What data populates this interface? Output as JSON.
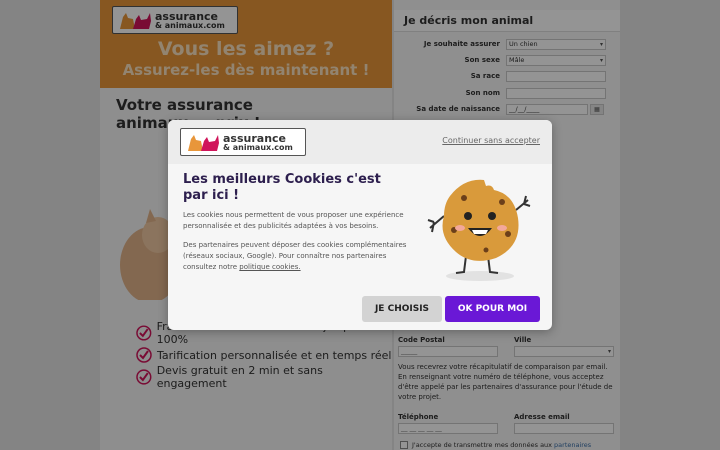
{
  "brand": {
    "name_line1": "assurance",
    "name_line2": "& animaux",
    "name_suffix": ".com"
  },
  "hero": {
    "headline": "Vous les aimez ?",
    "subline": "Assurez-les dès maintenant !"
  },
  "left": {
    "tagline": "Votre assurance animaux ... prix !",
    "benefits": [
      "Frais vétérinaires remboursés jusqu'à 100%",
      "Tarification personnalisée et en temps réel",
      "Devis gratuit en 2 min et sans engagement"
    ]
  },
  "form": {
    "title": "Je décris mon animal",
    "fields": [
      {
        "label": "Je souhaite assurer",
        "value": "Un chien",
        "type": "select"
      },
      {
        "label": "Son sexe",
        "value": "Mâle",
        "type": "select"
      },
      {
        "label": "Sa race",
        "value": "",
        "type": "text"
      },
      {
        "label": "Son nom",
        "value": "",
        "type": "text"
      },
      {
        "label": "Sa date de naissance",
        "value": "__/__/____",
        "type": "date"
      }
    ],
    "postal_label": "Code Postal",
    "postal_value": "_____",
    "city_label": "Ville",
    "recap_text": "Vous recevrez votre récapitulatif de comparaison par email. En renseignant votre numéro de téléphone, vous acceptez d'être appelé par les partenaires d'assurance pour l'étude de votre projet.",
    "phone_label": "Téléphone",
    "phone_value": "__ __ __ __ __",
    "email_label": "Adresse email",
    "consent_text": "J'accepte de transmettre mes données aux",
    "consent_link": "partenaires"
  },
  "cookie_modal": {
    "continue_link": "Continuer sans accepter",
    "title": "Les meilleurs Cookies c'est par ici !",
    "paragraph1": "Les cookies nous permettent de vous proposer une expérience personnalisée et des publicités adaptées à vos besoins.",
    "paragraph2": "Des partenaires peuvent déposer des cookies complémentaires (réseaux sociaux, Google). Pour connaître nos partenaires consultez notre",
    "policy_link": "politique cookies.",
    "choose_button": "JE CHOISIS",
    "accept_button": "OK POUR MOI"
  },
  "colors": {
    "accent": "#6a18d6",
    "hero_orange": "#e8963a",
    "check_pink": "#d0145a"
  }
}
